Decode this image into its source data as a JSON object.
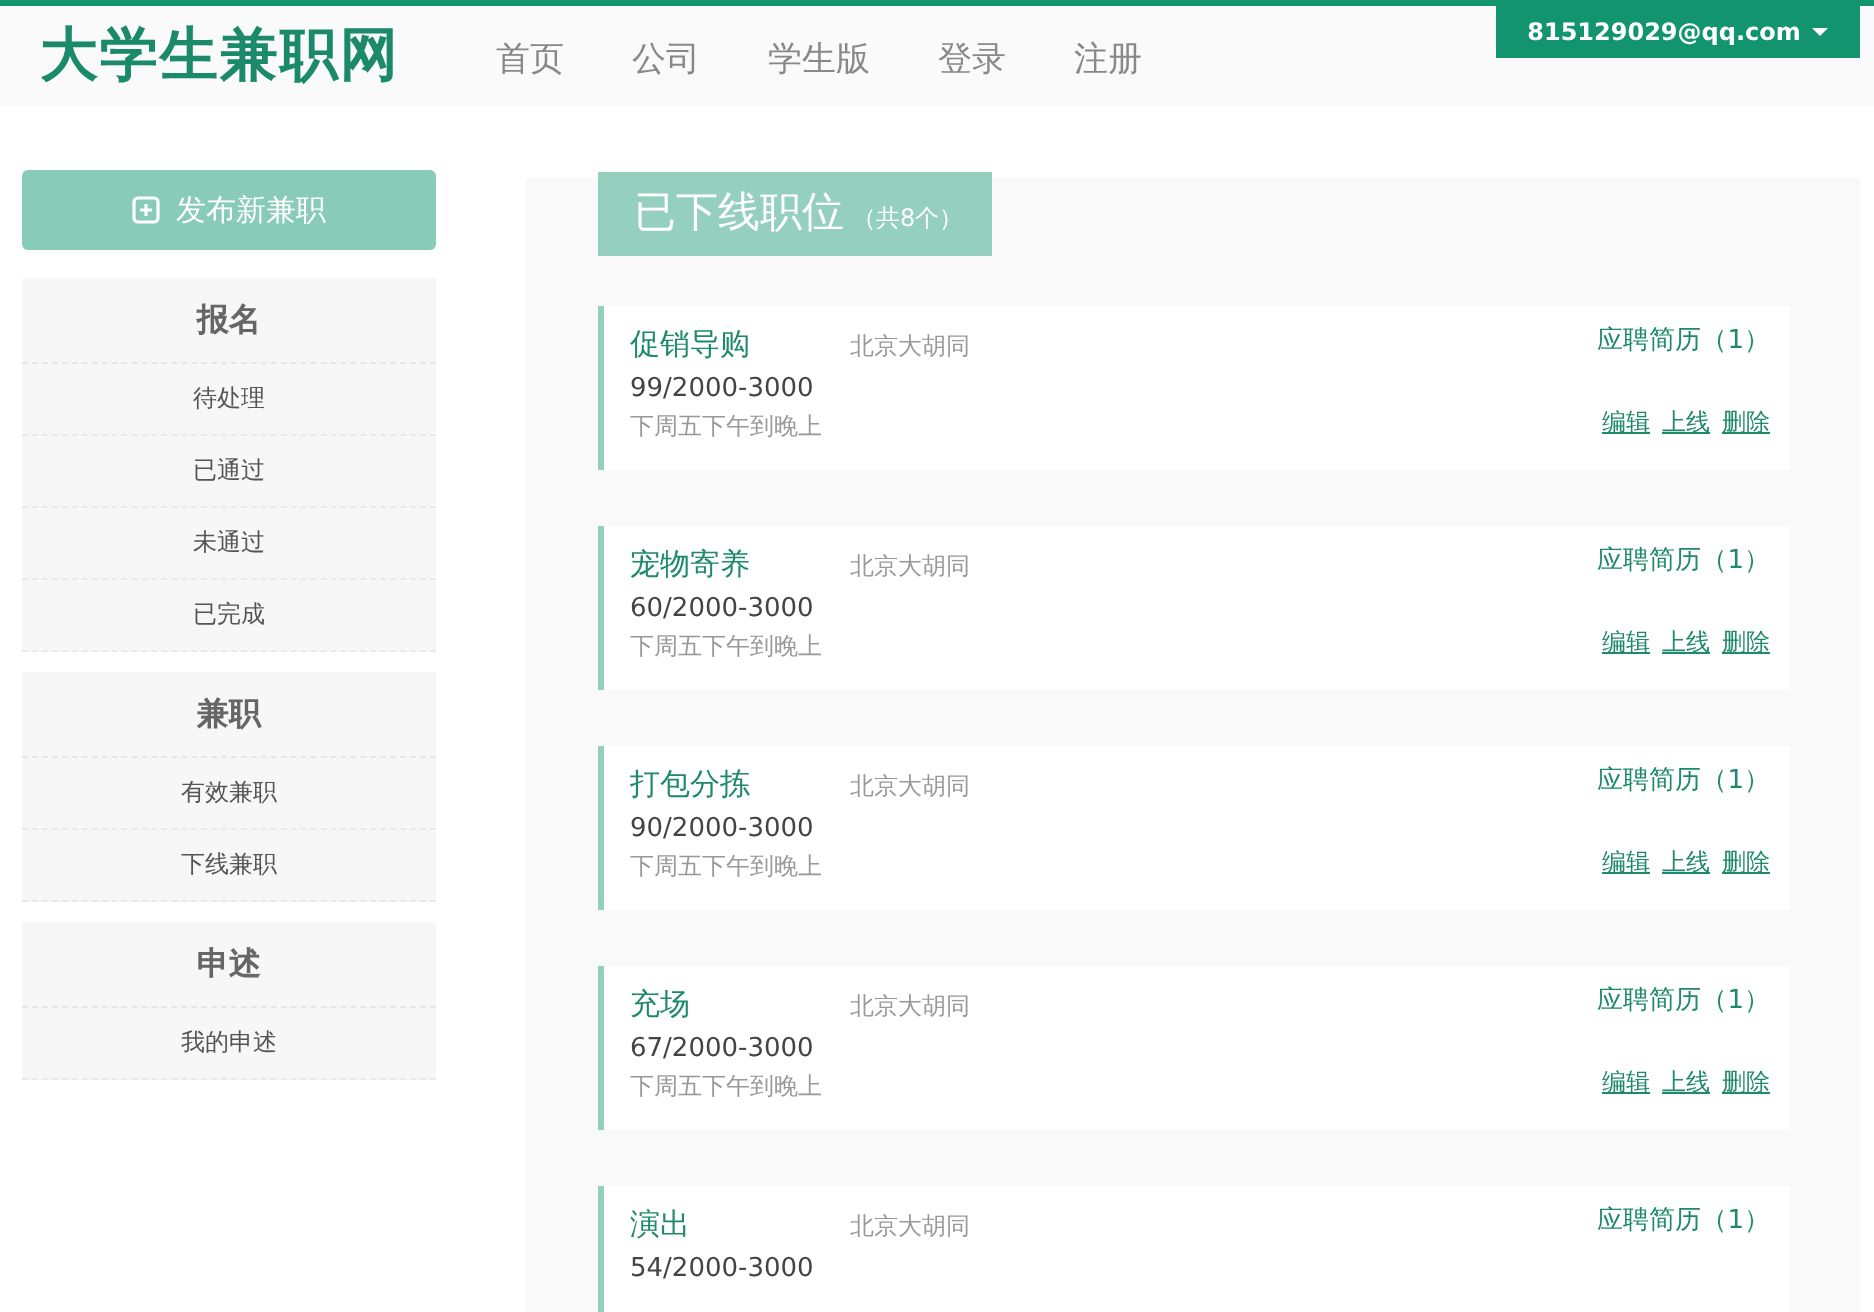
{
  "site": {
    "logo": "大学生兼职网",
    "nav": [
      {
        "label": "首页"
      },
      {
        "label": "公司"
      },
      {
        "label": "学生版"
      },
      {
        "label": "登录"
      },
      {
        "label": "注册"
      }
    ],
    "user_menu": "815129029@qq.com"
  },
  "sidebar": {
    "publish_button": "发布新兼职",
    "sections": [
      {
        "title": "报名",
        "items": [
          "待处理",
          "已通过",
          "未通过",
          "已完成"
        ]
      },
      {
        "title": "兼职",
        "items": [
          "有效兼职",
          "下线兼职"
        ]
      },
      {
        "title": "申述",
        "items": [
          "我的申述"
        ]
      }
    ]
  },
  "main": {
    "heading": "已下线职位",
    "count": "（共8个）",
    "jobs": [
      {
        "title": "促销导购",
        "location": "北京大胡同",
        "salary": "99/2000-3000",
        "time": "下周五下午到晚上",
        "applications": "应聘简历（1）",
        "actions": [
          "编辑",
          "上线",
          "删除"
        ]
      },
      {
        "title": "宠物寄养",
        "location": "北京大胡同",
        "salary": "60/2000-3000",
        "time": "下周五下午到晚上",
        "applications": "应聘简历（1）",
        "actions": [
          "编辑",
          "上线",
          "删除"
        ]
      },
      {
        "title": "打包分拣",
        "location": "北京大胡同",
        "salary": "90/2000-3000",
        "time": "下周五下午到晚上",
        "applications": "应聘简历（1）",
        "actions": [
          "编辑",
          "上线",
          "删除"
        ]
      },
      {
        "title": "充场",
        "location": "北京大胡同",
        "salary": "67/2000-3000",
        "time": "下周五下午到晚上",
        "applications": "应聘简历（1）",
        "actions": [
          "编辑",
          "上线",
          "删除"
        ]
      },
      {
        "title": "演出",
        "location": "北京大胡同",
        "salary": "54/2000-3000",
        "applications": "应聘简历（1）"
      }
    ]
  }
}
